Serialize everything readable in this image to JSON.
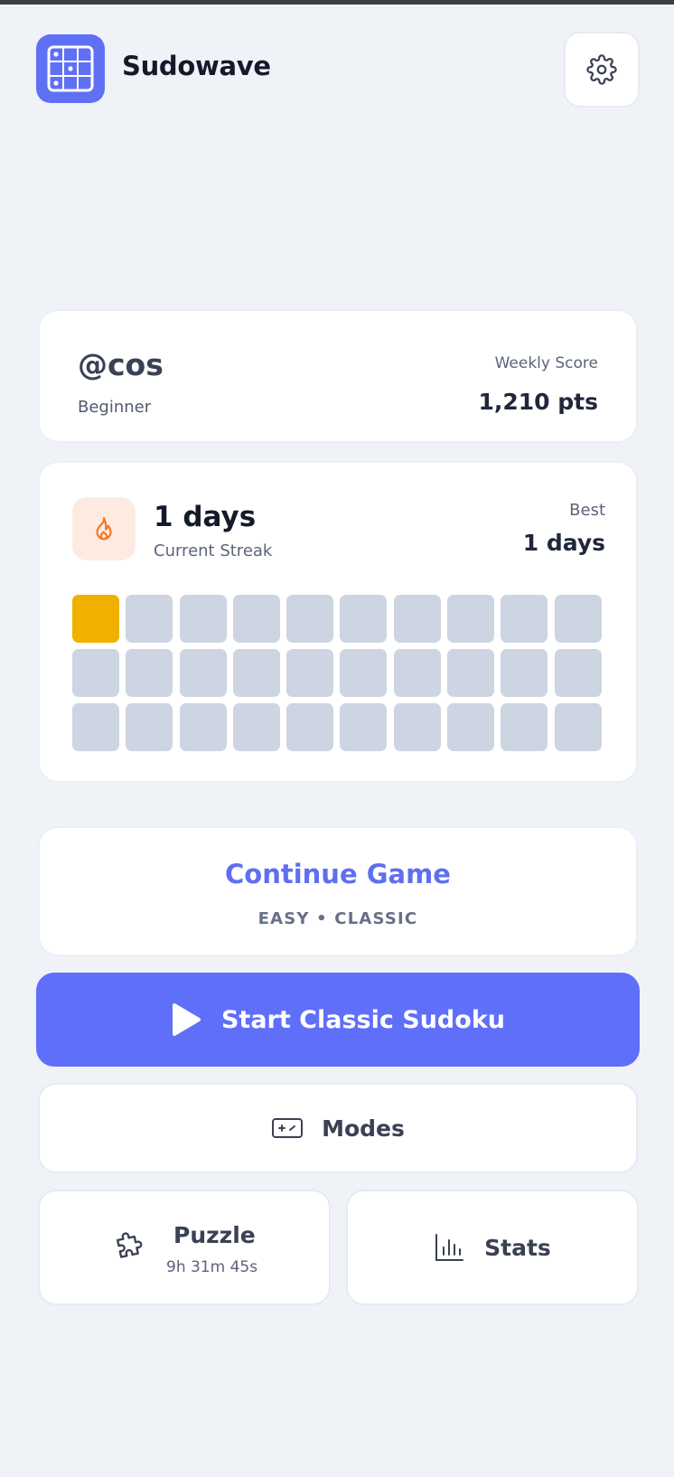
{
  "app": {
    "title": "Sudowave"
  },
  "profile": {
    "username": "@cos",
    "level": "Beginner",
    "weekly_score_label": "Weekly Score",
    "weekly_score_value": "1,210 pts"
  },
  "streak": {
    "current_value": "1 days",
    "current_label": "Current Streak",
    "best_label": "Best",
    "best_value": "1 days",
    "total_days": 30,
    "completed_days": 1
  },
  "continue_game": {
    "title": "Continue Game",
    "subtitle": "EASY • CLASSIC"
  },
  "actions": {
    "start_label": "Start Classic Sudoku",
    "modes_label": "Modes",
    "puzzle_label": "Puzzle",
    "puzzle_timer": "9h 31m 45s",
    "stats_label": "Stats"
  },
  "colors": {
    "accent": "#5f6ff9",
    "streak_done": "#f0b000",
    "streak_empty": "#ccd5e1",
    "flame": "#f07a2a"
  },
  "icons": {
    "app": "sudoku-grid-icon",
    "settings": "gear-icon",
    "streak": "flame-icon",
    "start": "play-icon",
    "modes": "gamepad-icon",
    "puzzle": "puzzle-piece-icon",
    "stats": "bar-chart-icon"
  }
}
